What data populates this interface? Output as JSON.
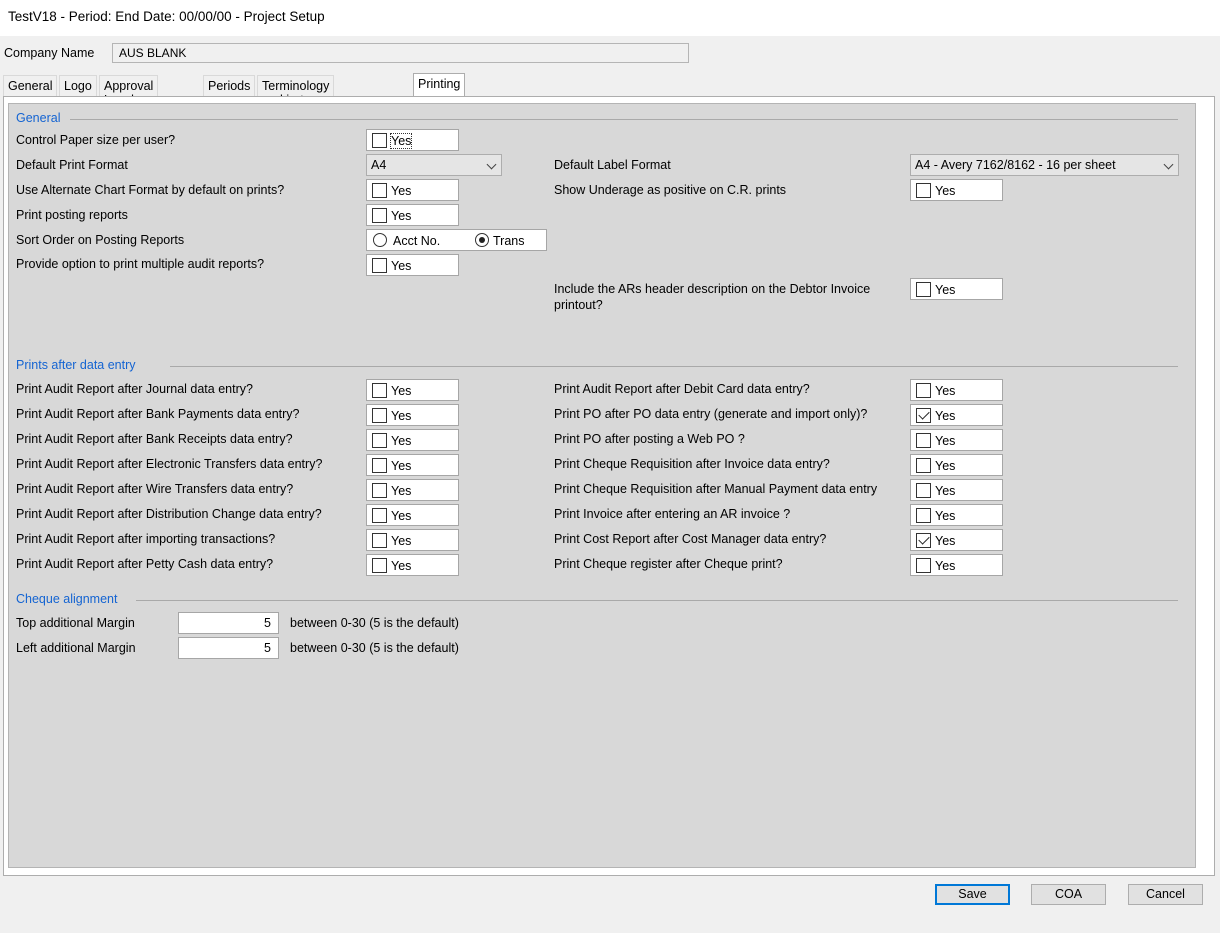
{
  "window": {
    "title": "TestV18  - Period:  End Date: 00/00/00 - Project Setup"
  },
  "company": {
    "label": "Company Name",
    "value": "AUS BLANK"
  },
  "tabs": [
    "General",
    "Logo",
    "Approval Levels",
    "Periods",
    "Terminology and in-trays",
    "Printing"
  ],
  "active_tab": "Printing",
  "general": {
    "heading": "General",
    "control_paper": {
      "label": "Control Paper size per user?",
      "checkbox": "Yes",
      "checked": false
    },
    "default_print_format": {
      "label": "Default Print Format",
      "value": "A4"
    },
    "default_label_format": {
      "label": "Default Label Format",
      "value": "A4 - Avery 7162/8162 - 16 per sheet"
    },
    "alt_chart": {
      "label": "Use Alternate Chart Format by default on prints?",
      "checkbox": "Yes",
      "checked": false
    },
    "underage": {
      "label": "Show Underage as positive on C.R. prints",
      "checkbox": "Yes",
      "checked": false
    },
    "posting_reports": {
      "label": "Print posting reports",
      "checkbox": "Yes",
      "checked": false
    },
    "sort_order": {
      "label": "Sort Order on Posting Reports",
      "option1": "Acct No.",
      "option2": "Trans",
      "selected": "Trans"
    },
    "multiple_audit": {
      "label": "Provide option to print multiple audit reports?",
      "checkbox": "Yes",
      "checked": false
    },
    "ars_header": {
      "label_line1": "Include the ARs header description on the Debtor Invoice",
      "label_line2": "printout?",
      "checkbox": "Yes",
      "checked": false
    }
  },
  "prints_after": {
    "heading": "Prints after data entry",
    "left": [
      {
        "label": "Print Audit Report after Journal data entry?",
        "checkbox": "Yes",
        "checked": false
      },
      {
        "label": "Print Audit Report after Bank Payments data entry?",
        "checkbox": "Yes",
        "checked": false
      },
      {
        "label": "Print Audit Report after Bank Receipts data entry?",
        "checkbox": "Yes",
        "checked": false
      },
      {
        "label": "Print Audit Report after Electronic Transfers data entry?",
        "checkbox": "Yes",
        "checked": false
      },
      {
        "label": "Print Audit Report after Wire Transfers data entry?",
        "checkbox": "Yes",
        "checked": false
      },
      {
        "label": "Print Audit Report after Distribution Change data entry?",
        "checkbox": "Yes",
        "checked": false
      },
      {
        "label": "Print Audit Report after importing transactions?",
        "checkbox": "Yes",
        "checked": false
      },
      {
        "label": "Print Audit Report after Petty Cash data entry?",
        "checkbox": "Yes",
        "checked": false
      }
    ],
    "right": [
      {
        "label": "Print Audit Report after Debit Card data entry?",
        "checkbox": "Yes",
        "checked": false
      },
      {
        "label": "Print PO after PO data entry (generate and import only)?",
        "checkbox": "Yes",
        "checked": true
      },
      {
        "label": "Print PO after posting a Web PO ?",
        "checkbox": "Yes",
        "checked": false
      },
      {
        "label": "Print Cheque Requisition after Invoice data entry?",
        "checkbox": "Yes",
        "checked": false
      },
      {
        "label": "Print Cheque Requisition after Manual Payment data entry",
        "checkbox": "Yes",
        "checked": false
      },
      {
        "label": "Print Invoice after entering an AR invoice ?",
        "checkbox": "Yes",
        "checked": false
      },
      {
        "label": "Print Cost Report after Cost Manager data entry?",
        "checkbox": "Yes",
        "checked": true
      },
      {
        "label": "Print Cheque register after Cheque print?",
        "checkbox": "Yes",
        "checked": false
      }
    ]
  },
  "cheque_alignment": {
    "heading": "Cheque alignment",
    "top": {
      "label": "Top additional Margin",
      "value": "5",
      "hint": "between 0-30 (5 is the default)"
    },
    "left": {
      "label": "Left additional Margin",
      "value": "5",
      "hint": "between 0-30 (5 is the default)"
    }
  },
  "buttons": {
    "save": "Save",
    "coa": "COA",
    "cancel": "Cancel"
  }
}
